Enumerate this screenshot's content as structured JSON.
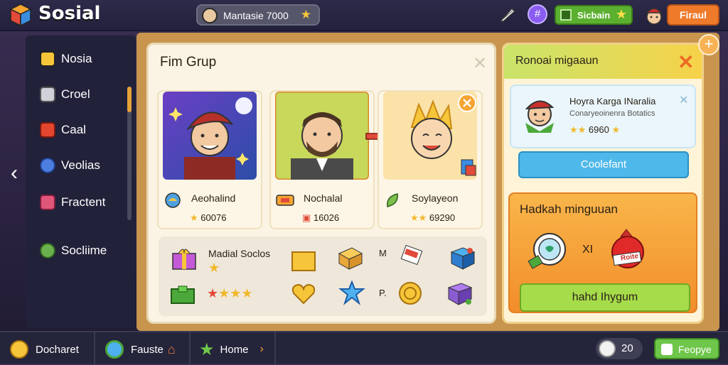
{
  "app": {
    "title": "Sosial"
  },
  "header": {
    "user_name": "Mantasie 7000",
    "status_label": "Sicbain",
    "action_button": "Firaul",
    "badge_icon": "hashtag-badge-icon"
  },
  "sidebar": {
    "items": [
      {
        "label": "Nosia",
        "color": "#f6c53a"
      },
      {
        "label": "Croel",
        "color": "#cfd2d8"
      },
      {
        "label": "Caal",
        "color": "#e2462e"
      },
      {
        "label": "Veolias",
        "color": "#4c7ee0"
      },
      {
        "label": "Fractent",
        "color": "#e0557a"
      },
      {
        "label": "Socliime",
        "color": "#6ab04c"
      }
    ]
  },
  "main_panel": {
    "title": "Fim Grup",
    "cards": [
      {
        "name": "Aeohalind",
        "score": "60076"
      },
      {
        "name": "Nochalal",
        "score": "16026"
      },
      {
        "name": "Soylayeon",
        "score": "69290"
      }
    ],
    "rewards": {
      "title": "Madial Soclos",
      "label_a": "M",
      "label_b": "P."
    }
  },
  "side_panel": {
    "title": "Ronoai migaaun",
    "player": {
      "name": "Hoyra Karga INaralia",
      "subtitle": "Conaryeoinenra Botatics",
      "score": "6960"
    },
    "blue_button": "Coolefant",
    "box_title": "Hadkah minguuan",
    "multiplier": "XI",
    "bag_label": "Roite",
    "green_button": "hahd Ihygum"
  },
  "bottom_bar": {
    "items": [
      {
        "label": "Docharet"
      },
      {
        "label": "Fauste"
      },
      {
        "label": "Home"
      }
    ],
    "coins": "20",
    "people_button": "Feopye"
  }
}
